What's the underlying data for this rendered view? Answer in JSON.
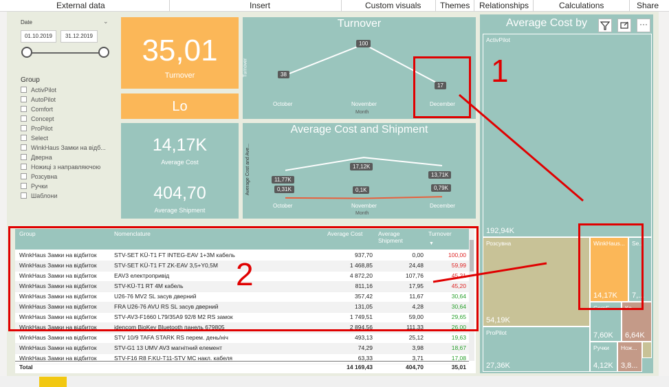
{
  "ribbon": {
    "external_data": "External data",
    "insert": "Insert",
    "custom_visuals": "Custom visuals",
    "themes": "Themes",
    "relationships": "Relationships",
    "calculations": "Calculations",
    "share": "Share"
  },
  "slicer": {
    "date_label": "Date",
    "date_from": "01.10.2019",
    "date_to": "31.12.2019",
    "group_label": "Group",
    "groups": [
      "ActivPilot",
      "AutoPilot",
      "Comfort",
      "Concept",
      "ProPilot",
      "Select",
      "WinkHaus Замки на відб...",
      "Дверна",
      "Ножиці з направляючою",
      "Розсувна",
      "Ручки",
      "Шаблони"
    ]
  },
  "cards": {
    "turnover_value": "35,01",
    "turnover_label": "Turnover",
    "lo_value": "Lo",
    "avg_cost_value": "14,17K",
    "avg_cost_label": "Average Cost",
    "avg_ship_value": "404,70",
    "avg_ship_label": "Average Shipment"
  },
  "turnover_chart": {
    "title": "Turnover",
    "ylabel": "Turnover",
    "xlabel": "Month",
    "categories": [
      "October",
      "November",
      "December"
    ],
    "labels": [
      "38",
      "100",
      "17"
    ]
  },
  "acs_chart": {
    "title": "Average Cost and Shipment",
    "ylabel": "Average Cost and Ave...",
    "xlabel": "Month",
    "categories": [
      "October",
      "November",
      "December"
    ],
    "cost_labels": [
      "11,77K",
      "17,12K",
      "13,71K"
    ],
    "ship_labels": [
      "0,31K",
      "0,1K",
      "0,79K"
    ]
  },
  "chart_data": [
    {
      "type": "line",
      "title": "Turnover",
      "xlabel": "Month",
      "ylabel": "Turnover",
      "categories": [
        "October",
        "November",
        "December"
      ],
      "values": [
        38,
        100,
        17
      ],
      "ylim": [
        0,
        110
      ]
    },
    {
      "type": "line",
      "title": "Average Cost and Shipment",
      "xlabel": "Month",
      "ylabel": "Average Cost and Ave...",
      "categories": [
        "October",
        "November",
        "December"
      ],
      "series": [
        {
          "values": [
            11770,
            17120,
            13710
          ],
          "color": "#ffffff"
        },
        {
          "values": [
            310,
            100,
            790
          ],
          "color": "#e8603c"
        }
      ],
      "ylim": [
        0,
        20000
      ]
    },
    {
      "type": "heatmap",
      "title": "Average Cost by",
      "categories": [
        "ActivPilot",
        "Розсувна",
        "WinkHaus Замки на відбиток",
        "ProPilot",
        "Ручки"
      ],
      "values": [
        192.94,
        54.19,
        14.17,
        27.36,
        4.12
      ],
      "value_labels": [
        "192,94K",
        "54,19K",
        "14,17K",
        "27,36K",
        "4,12K"
      ]
    }
  ],
  "table": {
    "headers": [
      "Group",
      "Nomenclature",
      "Average Cost",
      "Average Shipment",
      "Turnover"
    ],
    "rows": [
      [
        "WinkHaus Замки на відбиток",
        "STV-SET KÜ-T1 FT INTEG-EAV 1+3M кабель",
        "937,70",
        "0,00",
        "100,00"
      ],
      [
        "WinkHaus Замки на відбиток",
        "STV-SET KÜ-T1 FT ZK-EAV 3,5+Y0,5M",
        "1 468,85",
        "24,48",
        "59,99"
      ],
      [
        "WinkHaus Замки на відбиток",
        "EAV3 електропривід",
        "4 872,20",
        "107,76",
        "45,21"
      ],
      [
        "WinkHaus Замки на відбиток",
        "STV-KÜ-T1 RT 4M кабель",
        "811,16",
        "17,95",
        "45,20"
      ],
      [
        "WinkHaus Замки на відбиток",
        "U26-76 MV2 SL засув дверний",
        "357,42",
        "11,67",
        "30,64"
      ],
      [
        "WinkHaus Замки на відбиток",
        "FRA U26-76 AVU RS SL засув дверний",
        "131,05",
        "4,28",
        "30,64"
      ],
      [
        "WinkHaus Замки на відбиток",
        "STV-AV3-F1660 L79/35A9 92/8 M2 RS замок",
        "1 749,51",
        "59,00",
        "29,65"
      ],
      [
        "WinkHaus Замки на відбиток",
        "idencom BioKey Bluetooth панель 679805",
        "2 894,56",
        "111,33",
        "26,00"
      ],
      [
        "WinkHaus Замки на відбиток",
        "STV 10/9 TAFA STARK RS перем. день/ніч",
        "493,13",
        "25,12",
        "19,63"
      ],
      [
        "WinkHaus Замки на відбиток",
        "STV-G1 13 UMV AV3 магнітний елемент",
        "74,29",
        "3,98",
        "18,67"
      ],
      [
        "WinkHaus Замки на відбиток",
        "STV-F16 R8 F.KU-T11-STV MC накл. кабеля",
        "63,33",
        "3,71",
        "17,08"
      ]
    ],
    "turnover_colors": [
      "red",
      "red",
      "red",
      "red",
      "green",
      "green",
      "green",
      "green",
      "green",
      "green",
      "green"
    ],
    "total": {
      "label": "Total",
      "avg_cost": "14 169,43",
      "avg_ship": "404,70",
      "turnover": "35,01"
    }
  },
  "treemap": {
    "title": "Average Cost by",
    "cells": [
      {
        "name": "ActivPilot",
        "value": "192,94K"
      },
      {
        "name": "Розсувна",
        "value": "54,19K"
      },
      {
        "name": "WinkHaus...",
        "value": "14,17K"
      },
      {
        "name": "Se...",
        "value": "7,..."
      },
      {
        "name": "ProPilot",
        "value": "27,36K"
      },
      {
        "name": "ComF...",
        "value": "7,60K"
      },
      {
        "name": "Ко...",
        "value": "6,64K"
      },
      {
        "name": "Ручки",
        "value": "4,12K"
      },
      {
        "name": "Нож...",
        "value": "3,8..."
      }
    ]
  },
  "annotations": {
    "one": "1",
    "two": "2"
  },
  "colors": {
    "orange": "#fbb758",
    "teal": "#9ac5bd",
    "tan": "#c8c297",
    "annotation_red": "#e00000"
  }
}
